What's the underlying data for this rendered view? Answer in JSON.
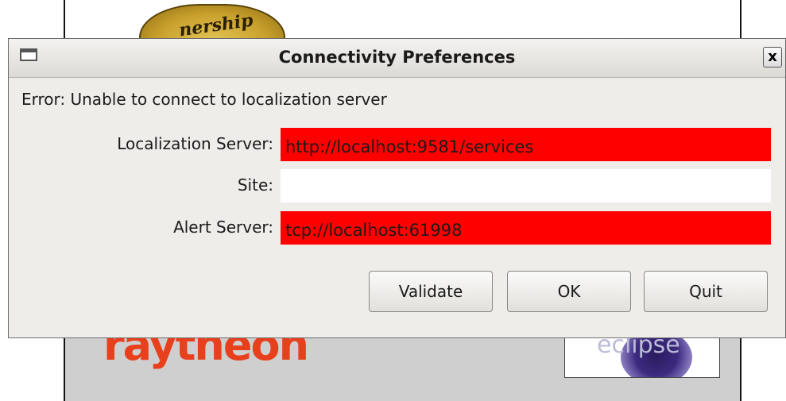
{
  "background": {
    "seal_text": "nership",
    "brand_logo_text": "raytheon",
    "eclipse_text": "eclipse"
  },
  "dialog": {
    "title": "Connectivity Preferences",
    "close_label": "x",
    "error_message": "Error: Unable to connect to localization server",
    "fields": {
      "localization_server": {
        "label": "Localization Server:",
        "value": "http://localhost:9581/services",
        "status": "invalid",
        "status_color": "#ff0000"
      },
      "site": {
        "label": "Site:",
        "value": "",
        "status": "valid",
        "status_color": "#ffffff"
      },
      "alert_server": {
        "label": "Alert Server:",
        "value": "tcp://localhost:61998",
        "status": "invalid",
        "status_color": "#ff0000"
      }
    },
    "buttons": {
      "validate": "Validate",
      "ok": "OK",
      "quit": "Quit"
    }
  },
  "icons": {
    "window_menu": "window-icon",
    "close": "close-icon"
  }
}
